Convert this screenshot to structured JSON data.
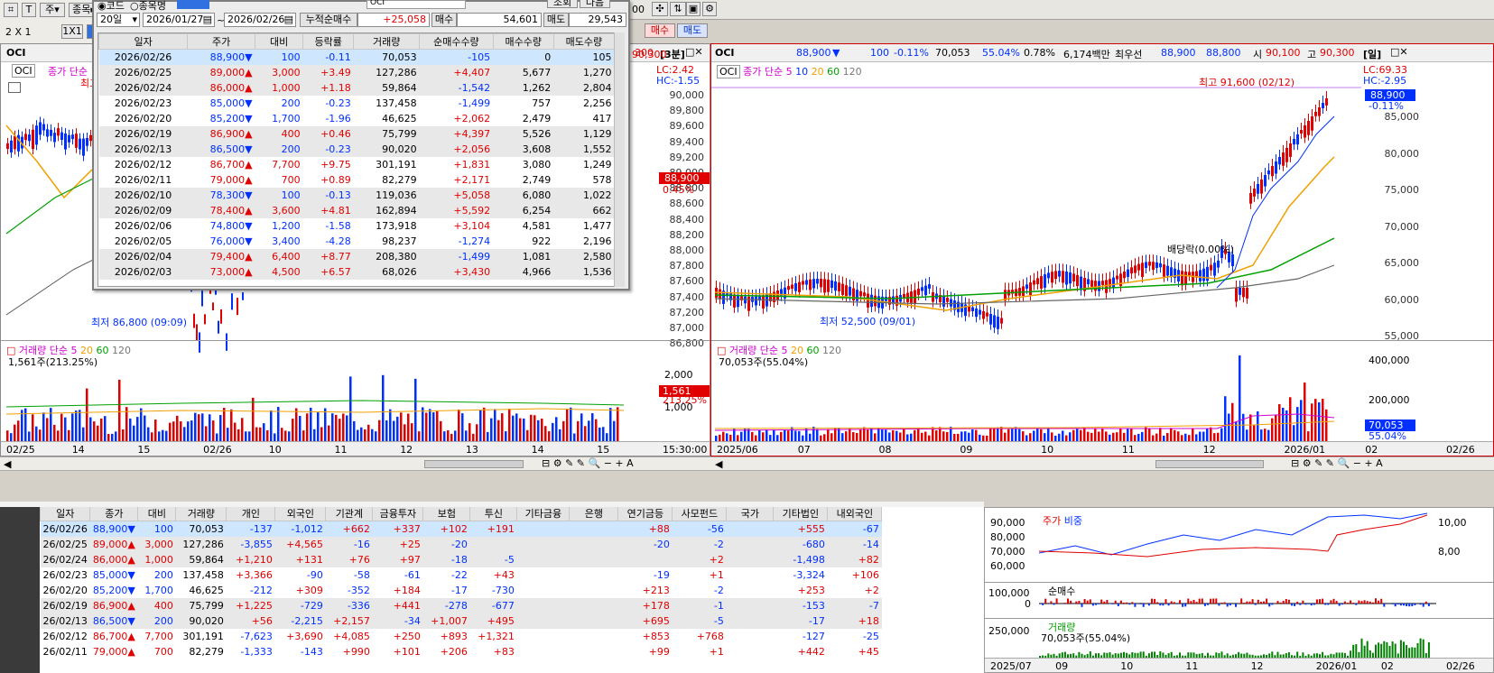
{
  "toolbar": {
    "layout_label": "2 X 1",
    "ratio_label": "1X1",
    "radio_code": "코드",
    "radio_name": "종목명",
    "stock_name": "OCI",
    "period": "20일",
    "date_from": "2026/01/27",
    "date_to": "2026/02/26",
    "cum_label": "누적순매수",
    "cum_value": "+25,058",
    "buy_label": "매수",
    "buy_value": "54,601",
    "sell_label": "매도",
    "sell_value": "29,543",
    "inquire": "조회",
    "next": "다음",
    "btn_buy": "매수",
    "btn_sell": "매도"
  },
  "popup": {
    "headers": [
      "일자",
      "주가",
      "대비",
      "등락률",
      "거래량",
      "순매수수량",
      "매수수량",
      "매도수량"
    ],
    "rows": [
      [
        "2026/02/26",
        "88,900",
        "▼",
        "100",
        "-0.11",
        "70,053",
        "-105",
        "0",
        "105"
      ],
      [
        "2026/02/25",
        "89,000",
        "▲",
        "3,000",
        "+3.49",
        "127,286",
        "+4,407",
        "5,677",
        "1,270"
      ],
      [
        "2026/02/24",
        "86,000",
        "▲",
        "1,000",
        "+1.18",
        "59,864",
        "-1,542",
        "1,262",
        "2,804"
      ],
      [
        "2026/02/23",
        "85,000",
        "▼",
        "200",
        "-0.23",
        "137,458",
        "-1,499",
        "757",
        "2,256"
      ],
      [
        "2026/02/20",
        "85,200",
        "▼",
        "1,700",
        "-1.96",
        "46,625",
        "+2,062",
        "2,479",
        "417"
      ],
      [
        "2026/02/19",
        "86,900",
        "▲",
        "400",
        "+0.46",
        "75,799",
        "+4,397",
        "5,526",
        "1,129"
      ],
      [
        "2026/02/13",
        "86,500",
        "▼",
        "200",
        "-0.23",
        "90,020",
        "+2,056",
        "3,608",
        "1,552"
      ],
      [
        "2026/02/12",
        "86,700",
        "▲",
        "7,700",
        "+9.75",
        "301,191",
        "+1,831",
        "3,080",
        "1,249"
      ],
      [
        "2026/02/11",
        "79,000",
        "▲",
        "700",
        "+0.89",
        "82,279",
        "+2,171",
        "2,749",
        "578"
      ],
      [
        "2026/02/10",
        "78,300",
        "▼",
        "100",
        "-0.13",
        "119,036",
        "+5,058",
        "6,080",
        "1,022"
      ],
      [
        "2026/02/09",
        "78,400",
        "▲",
        "3,600",
        "+4.81",
        "162,894",
        "+5,592",
        "6,254",
        "662"
      ],
      [
        "2026/02/06",
        "74,800",
        "▼",
        "1,200",
        "-1.58",
        "173,918",
        "+3,104",
        "4,581",
        "1,477"
      ],
      [
        "2026/02/05",
        "76,000",
        "▼",
        "3,400",
        "-4.28",
        "98,237",
        "-1,274",
        "922",
        "2,196"
      ],
      [
        "2026/02/04",
        "79,400",
        "▲",
        "6,400",
        "+8.77",
        "208,380",
        "-1,499",
        "1,081",
        "2,580"
      ],
      [
        "2026/02/03",
        "73,000",
        "▲",
        "4,500",
        "+6.57",
        "68,026",
        "+3,430",
        "4,966",
        "1,536"
      ]
    ]
  },
  "left_chart": {
    "title": "OCI",
    "legend_price": "종가 단순",
    "lc": "LC:2.42",
    "hc": "HC:-1.55",
    "tag_price": "88,900",
    "tag_pct": "0.45%",
    "low_label": "최저 86,800 (09:09)",
    "high_label": "최고",
    "y_ticks": [
      "90,000",
      "89,800",
      "89,600",
      "89,400",
      "89,200",
      "89,000",
      "88,800",
      "88,600",
      "88,400",
      "88,200",
      "88,000",
      "87,800",
      "87,600",
      "87,400",
      "87,200",
      "87,000",
      "86,800"
    ],
    "vol_legend": "거래량 단순",
    "vol_info": "1,561주(213.25%)",
    "vol_ticks": [
      "2,000",
      "1,000"
    ],
    "vol_tag": "1,561",
    "vol_tag_pct": "213.25%",
    "x_ticks": [
      "02/25",
      "14",
      "15",
      "02/26",
      "10",
      "11",
      "12",
      "13",
      "14",
      "15",
      "15:30:00"
    ]
  },
  "right_chart": {
    "title": "OCI",
    "price": "88,900",
    "arrow": "▼",
    "change": "100",
    "pct": "-0.11%",
    "volume": "70,053",
    "vol_pct": "55.04%",
    "turnover": "0.78%",
    "amount": "6,174백만",
    "best_label": "최우선",
    "best_ask": "88,900",
    "best_bid": "88,800",
    "open_label": "시",
    "open": "90,100",
    "high_label": "고",
    "high": "90,300",
    "period_tag": "[일]",
    "legend": "종가 단순",
    "ma": [
      "5",
      "10",
      "20",
      "60",
      "120"
    ],
    "lc": "LC:69.33",
    "hc": "HC:-2.95",
    "tag_price": "88,900",
    "tag_pct": "-0.11%",
    "high_note": "최고 91,600 (02/12)",
    "low_note": "최저 52,500 (09/01)",
    "div_note": "배당락(0.00%)",
    "y_ticks": [
      "85,000",
      "80,000",
      "75,000",
      "70,000",
      "65,000",
      "60,000",
      "55,000"
    ],
    "vol_legend": "거래량 단순",
    "vol_info": "70,053주(55.04%)",
    "vol_ticks": [
      "400,000",
      "200,000"
    ],
    "vol_tag": "70,053",
    "vol_tag_pct": "55.04%",
    "x_ticks": [
      "2025/06",
      "07",
      "08",
      "09",
      "10",
      "11",
      "12",
      "2026/01",
      "02",
      "02/26"
    ]
  },
  "mid_header": {
    "left_red": "300",
    "period_tag": "[3분]",
    "top_right_red": "90,300"
  },
  "bottom_table": {
    "headers": [
      "일자",
      "종가",
      "대비",
      "거래량",
      "개인",
      "외국인",
      "기관계",
      "금융투자",
      "보험",
      "투신",
      "기타금융",
      "은행",
      "연기금등",
      "사모펀드",
      "국가",
      "기타법인",
      "내외국인"
    ],
    "rows": [
      [
        "26/02/26",
        "88,900",
        "▼",
        "100",
        "70,053",
        "-137",
        "-1,012",
        "+662",
        "+337",
        "+102",
        "+191",
        "",
        "",
        "+88",
        "-56",
        "",
        "+555",
        "-67"
      ],
      [
        "26/02/25",
        "89,000",
        "▲",
        "3,000",
        "127,286",
        "-3,855",
        "+4,565",
        "-16",
        "+25",
        "-20",
        "",
        "",
        "",
        "-20",
        "-2",
        "",
        "-680",
        "-14"
      ],
      [
        "26/02/24",
        "86,000",
        "▲",
        "1,000",
        "59,864",
        "+1,210",
        "+131",
        "+76",
        "+97",
        "-18",
        "-5",
        "",
        "",
        "",
        "+2",
        "",
        "-1,498",
        "+82"
      ],
      [
        "26/02/23",
        "85,000",
        "▼",
        "200",
        "137,458",
        "+3,366",
        "-90",
        "-58",
        "-61",
        "-22",
        "+43",
        "",
        "",
        "-19",
        "+1",
        "",
        "-3,324",
        "+106"
      ],
      [
        "26/02/20",
        "85,200",
        "▼",
        "1,700",
        "46,625",
        "-212",
        "+309",
        "-352",
        "+184",
        "-17",
        "-730",
        "",
        "",
        "+213",
        "-2",
        "",
        "+253",
        "+2"
      ],
      [
        "26/02/19",
        "86,900",
        "▲",
        "400",
        "75,799",
        "+1,225",
        "-729",
        "-336",
        "+441",
        "-278",
        "-677",
        "",
        "",
        "+178",
        "-1",
        "",
        "-153",
        "-7"
      ],
      [
        "26/02/13",
        "86,500",
        "▼",
        "200",
        "90,020",
        "+56",
        "-2,215",
        "+2,157",
        "-34",
        "+1,007",
        "+495",
        "",
        "",
        "+695",
        "-5",
        "",
        "-17",
        "+18"
      ],
      [
        "26/02/12",
        "86,700",
        "▲",
        "7,700",
        "301,191",
        "-7,623",
        "+3,690",
        "+4,085",
        "+250",
        "+893",
        "+1,321",
        "",
        "",
        "+853",
        "+768",
        "",
        "-127",
        "-25"
      ],
      [
        "26/02/11",
        "79,000",
        "▲",
        "700",
        "82,279",
        "-1,333",
        "-143",
        "+990",
        "+101",
        "+206",
        "+83",
        "",
        "",
        "+99",
        "+1",
        "",
        "+442",
        "+45"
      ]
    ]
  },
  "mini_chart": {
    "legend_price": "주가",
    "legend_ratio": "비중",
    "y_left": [
      "90,000",
      "80,000",
      "70,000",
      "60,000"
    ],
    "y_right": [
      "10,00",
      "8,00"
    ],
    "net_label": "순매수",
    "net_ticks": [
      "100,000",
      "0"
    ],
    "vol_label": "거래량",
    "vol_info": "70,053주(55.04%)",
    "vol_ticks": [
      "250,000"
    ],
    "x_ticks": [
      "2025/07",
      "09",
      "10",
      "11",
      "12",
      "2026/01",
      "02",
      "02/26"
    ]
  }
}
